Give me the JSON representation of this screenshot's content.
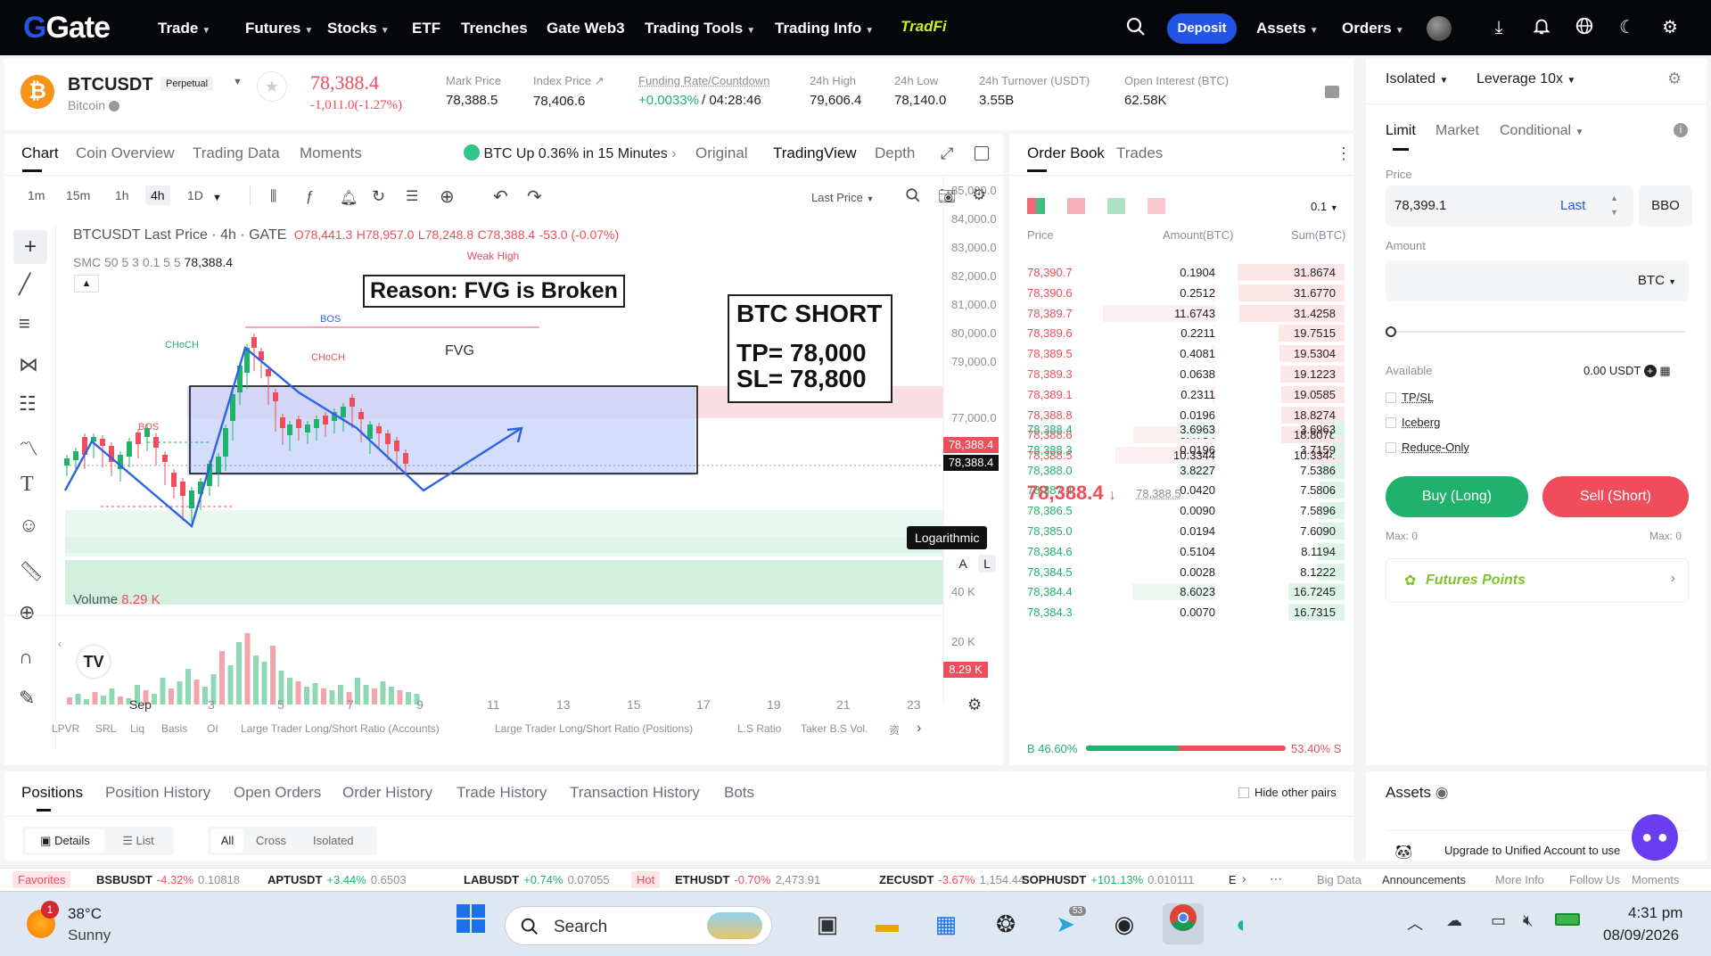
{
  "nav": {
    "logo": "Gate",
    "items": [
      {
        "label": "Trade",
        "chevron": true
      },
      {
        "label": "Futures",
        "chevron": true
      },
      {
        "label": "Stocks",
        "chevron": true
      },
      {
        "label": "ETF",
        "chevron": false
      },
      {
        "label": "Trenches",
        "chevron": false
      },
      {
        "label": "Gate Web3",
        "chevron": false
      },
      {
        "label": "Trading Tools",
        "chevron": true
      },
      {
        "label": "Trading Info",
        "chevron": true
      }
    ],
    "tradfi": "TradFi",
    "deposit": "Deposit",
    "assets": "Assets",
    "orders": "Orders",
    "accent": "#2354e6"
  },
  "ticker": {
    "symbol": "BTCUSDT",
    "contract_type": "Perpetual",
    "name": "Bitcoin",
    "last_price": "78,388.4",
    "change": "-1,011.0(-1.27%)",
    "stats": [
      {
        "label": "Mark Price",
        "value": "78,388.5"
      },
      {
        "label": "Index Price ↗",
        "value": "78,406.6"
      },
      {
        "label": "Funding Rate/Countdown",
        "value": "+0.0033%",
        "value2": "/ 04:28:46"
      },
      {
        "label": "24h High",
        "value": "79,606.4"
      },
      {
        "label": "24h Low",
        "value": "78,140.0"
      },
      {
        "label": "24h Turnover (USDT)",
        "value": "3.55B"
      },
      {
        "label": "Open Interest (BTC)",
        "value": "62.58K"
      }
    ]
  },
  "chart_tabs": {
    "tabs": [
      "Chart",
      "Coin Overview",
      "Trading Data",
      "Moments"
    ],
    "banner": "BTC Up 0.36% in 15 Minutes",
    "views": [
      "Original",
      "TradingView",
      "Depth"
    ],
    "intervals": [
      "1m",
      "15m",
      "1h",
      "4h",
      "1D"
    ],
    "active_interval": "4h",
    "price_source": "Last Price"
  },
  "chart": {
    "header": "BTCUSDT Last Price · 4h · GATE",
    "ohlc": {
      "o": "O78,441.3",
      "h": "H78,957.0",
      "l": "L78,248.8",
      "c": "C78,388.4",
      "chg": "-53.0 (-0.07%)"
    },
    "smc_label": "SMC 50 5 3 0.1 5 5",
    "smc_value": "78,388.4",
    "annotation_reason": "Reason: FVG is Broken",
    "annotation_title": "BTC SHORT",
    "annotation_tp": "TP= 78,000",
    "annotation_sl": "SL= 78,800",
    "labels": {
      "weak_high": "Weak High",
      "fvg": "FVG",
      "bos": "BOS",
      "bos2": "BOS",
      "choch": "CHoCH",
      "choch2": "CHoCH"
    },
    "price_axis": [
      "85,000.0",
      "84,000.0",
      "83,000.0",
      "82,000.0",
      "81,000.0",
      "80,000.0",
      "79,000.0",
      "77,000.0"
    ],
    "price_tag_red": "78,388.4",
    "price_tag_black": "78,388.4",
    "scale_tooltip": "Logarithmic",
    "scale_buttons": [
      "A",
      "L"
    ],
    "volume_label": "Volume",
    "volume_value": "8.29 K",
    "volume_axis": [
      "40 K",
      "20 K"
    ],
    "volume_tag": "8.29 K",
    "time_axis": [
      "Sep",
      "3",
      "5",
      "7",
      "9",
      "11",
      "13",
      "15",
      "17",
      "19",
      "21",
      "23"
    ],
    "indicators": [
      "LPVR",
      "SRL",
      "Liq",
      "Basis",
      "OI",
      "Large Trader Long/Short Ratio (Accounts)",
      "Large Trader Long/Short Ratio (Positions)",
      "L.S Ratio",
      "Taker B.S Vol.",
      "资"
    ]
  },
  "orderbook": {
    "tabs": [
      "Order Book",
      "Trades"
    ],
    "precision": "0.1",
    "headers": [
      "Price",
      "Amount(BTC)",
      "Sum(BTC)"
    ],
    "asks": [
      [
        "78,390.7",
        "0.1904",
        "31.8674"
      ],
      [
        "78,390.6",
        "0.2512",
        "31.6770"
      ],
      [
        "78,389.7",
        "11.6743",
        "31.4258"
      ],
      [
        "78,389.6",
        "0.2211",
        "19.7515"
      ],
      [
        "78,389.5",
        "0.4081",
        "19.5304"
      ],
      [
        "78,389.3",
        "0.0638",
        "19.1223"
      ],
      [
        "78,389.1",
        "0.2311",
        "19.0585"
      ],
      [
        "78,388.8",
        "0.0196",
        "18.8274"
      ],
      [
        "78,388.6",
        "8.4734",
        "18.8078"
      ],
      [
        "78,388.5",
        "10.3344",
        "10.3344"
      ]
    ],
    "mid_price": "78,388.4",
    "mid_mark": "78,388.5",
    "bids": [
      [
        "78,388.4",
        "3.6963",
        "3.6963"
      ],
      [
        "78,388.3",
        "0.0196",
        "3.7159"
      ],
      [
        "78,388.0",
        "3.8227",
        "7.5386"
      ],
      [
        "78,387.4",
        "0.0420",
        "7.5806"
      ],
      [
        "78,386.5",
        "0.0090",
        "7.5896"
      ],
      [
        "78,385.0",
        "0.0194",
        "7.6090"
      ],
      [
        "78,384.6",
        "0.5104",
        "8.1194"
      ],
      [
        "78,384.5",
        "0.0028",
        "8.1222"
      ],
      [
        "78,384.4",
        "8.6023",
        "16.7245"
      ],
      [
        "78,384.3",
        "0.0070",
        "16.7315"
      ]
    ],
    "buy_ratio": "B 46.60%",
    "sell_ratio": "53.40% S",
    "buy_fraction": 0.466
  },
  "order_form": {
    "margin_mode": "Isolated",
    "leverage": "Leverage 10x",
    "types": [
      "Limit",
      "Market",
      "Conditional"
    ],
    "price_label": "Price",
    "price_value": "78,399.1",
    "price_ref": "Last",
    "bbo": "BBO",
    "amount_label": "Amount",
    "amount_unit": "BTC",
    "available_label": "Available",
    "available_value": "0.00 USDT",
    "options": [
      "TP/SL",
      "Iceberg",
      "Reduce-Only"
    ],
    "buy": "Buy (Long)",
    "sell": "Sell (Short)",
    "max_buy": "Max: 0",
    "max_sell": "Max: 0",
    "points": "Futures Points"
  },
  "bottom": {
    "tabs": [
      "Positions",
      "Position History",
      "Open Orders",
      "Order History",
      "Trade History",
      "Transaction History",
      "Bots"
    ],
    "hide_pairs": "Hide other pairs",
    "views": [
      "Details",
      "List"
    ],
    "filters": [
      "All",
      "Cross",
      "Isolated"
    ],
    "assets_title": "Assets",
    "upgrade": "Upgrade to Unified Account to use"
  },
  "statusbar": {
    "favorites": "Favorites",
    "items": [
      {
        "sym": "BSBUSDT",
        "chg": "-4.32%",
        "px": "0.10818",
        "up": false
      },
      {
        "sym": "APTUSDT",
        "chg": "+3.44%",
        "px": "0.6503",
        "up": true
      },
      {
        "sym": "LABUSDT",
        "chg": "+0.74%",
        "px": "0.07055",
        "up": true
      }
    ],
    "hot": "Hot",
    "hot_items": [
      {
        "sym": "ETHUSDT",
        "chg": "-0.70%",
        "px": "2,473.91",
        "up": false
      },
      {
        "sym": "ZECUSDT",
        "chg": "-3.67%",
        "px": "1,154.44",
        "up": false
      },
      {
        "sym": "SOPHUSDT",
        "chg": "+101.13%",
        "px": "0.010111",
        "up": true
      }
    ],
    "more_sym": "E",
    "links": [
      "Big Data",
      "Announcements",
      "More Info",
      "Follow Us",
      "Moments"
    ]
  },
  "taskbar": {
    "temp": "38°C",
    "weather": "Sunny",
    "weather_badge": "1",
    "search": "Search",
    "telegram_badge": "53",
    "time": "4:31 pm",
    "date": "08/09/2026"
  }
}
